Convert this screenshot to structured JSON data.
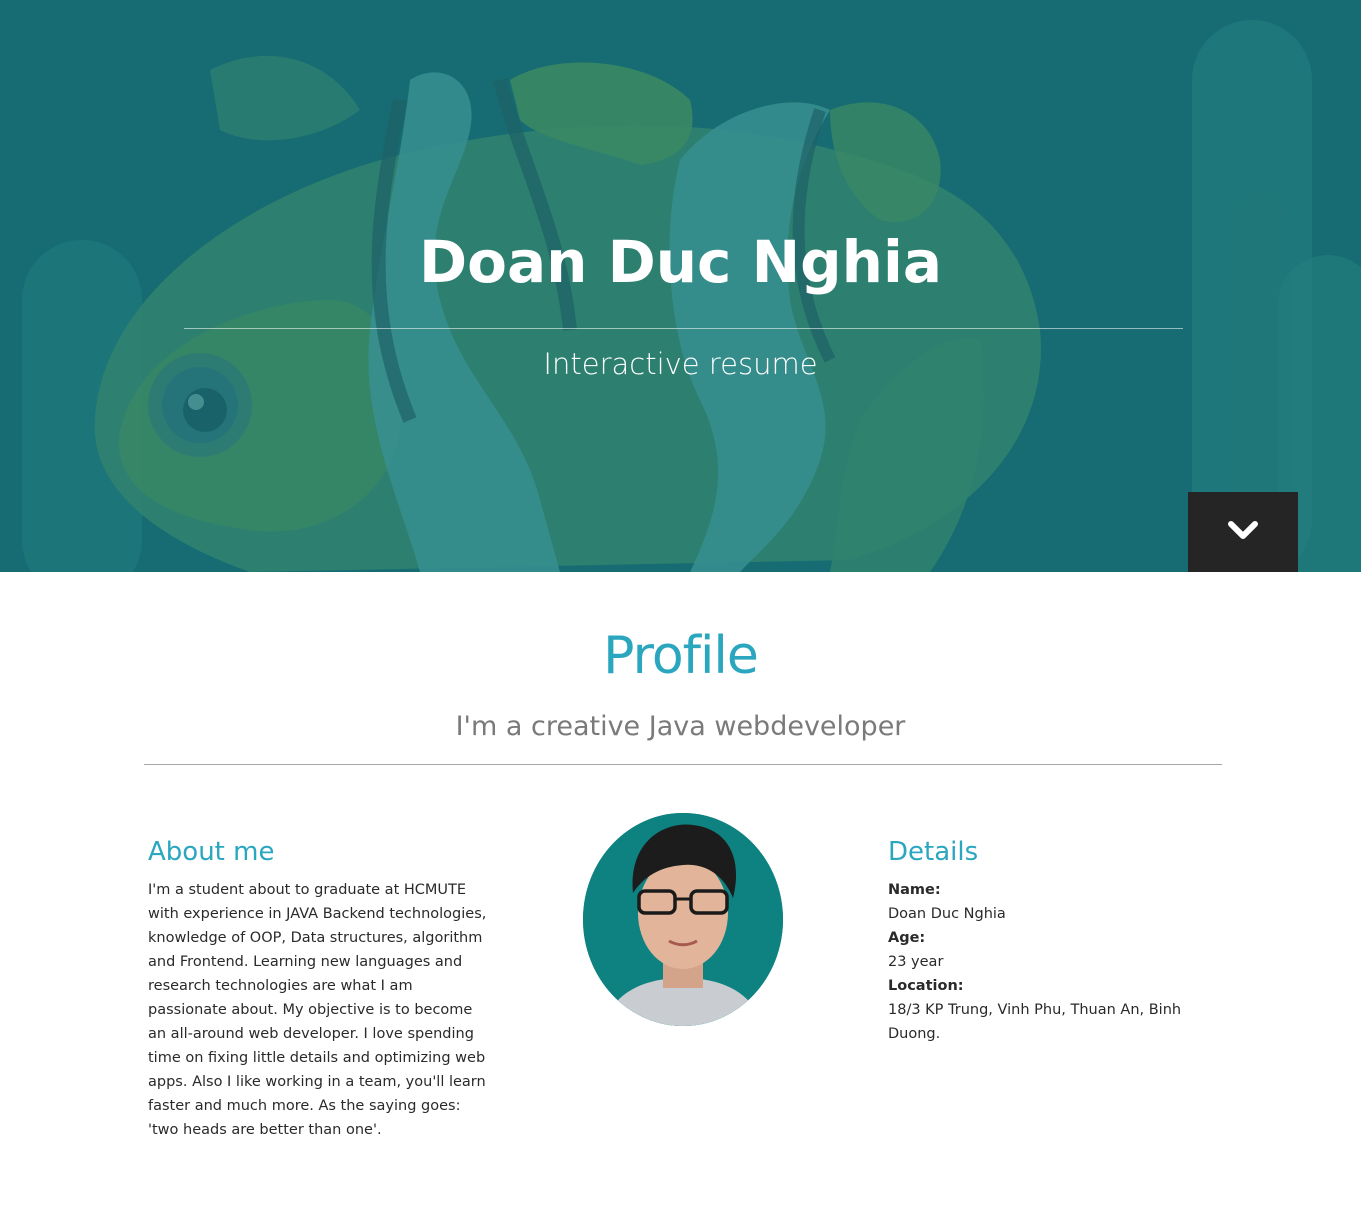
{
  "hero": {
    "title": "Doan Duc Nghia",
    "subtitle": "Interactive resume",
    "scroll_icon": "chevron-down-icon",
    "background_color": "#186e73",
    "art": "clownfish-illustration"
  },
  "profile": {
    "title": "Profile",
    "tagline": "I'm a creative Java webdeveloper",
    "accent_color": "#2aa6bf"
  },
  "about": {
    "heading": "About me",
    "text": "I'm a student about to graduate at HCMUTE with experience in JAVA Backend technologies, knowledge of OOP, Data structures, algorithm and Frontend. Learning new languages and research technologies are what I am passionate about. My objective is to become an all-around web developer. I love spending time on fixing little details and optimizing web apps. Also I like working in a team, you'll learn faster and much more. As the saying goes: 'two heads are better than one'."
  },
  "avatar": {
    "description": "profile-photo",
    "background_color": "#0e8281"
  },
  "details": {
    "heading": "Details",
    "name_label": "Name:",
    "name_value": "Doan Duc Nghia",
    "age_label": "Age:",
    "age_value": "23 year",
    "location_label": "Location:",
    "location_value": "18/3 KP Trung, Vinh Phu, Thuan An, Binh Duong."
  }
}
